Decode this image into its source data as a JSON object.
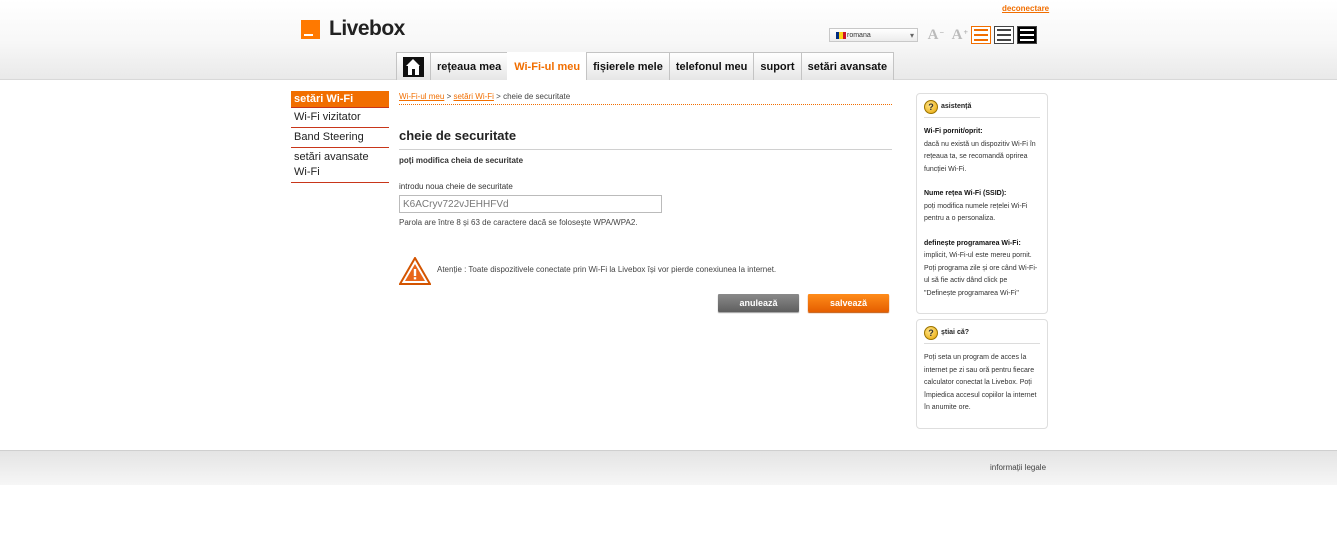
{
  "header": {
    "logo_text": "Livebox",
    "logout": "deconectare",
    "language": "romana",
    "font_decrease_icon": "font-decrease-icon",
    "font_increase_icon": "font-increase-icon"
  },
  "nav": {
    "home_icon": "home-icon",
    "items": [
      "rețeaua mea",
      "Wi-Fi-ul meu",
      "fișierele mele",
      "telefonul meu",
      "suport",
      "setări avansate"
    ],
    "active_index": 1
  },
  "sidebar": {
    "items": [
      "setări Wi-Fi",
      "Wi-Fi vizitator",
      "Band Steering",
      "setări avansate Wi-Fi"
    ],
    "active_index": 0
  },
  "breadcrumb": {
    "level1": "Wi-Fi-ul meu",
    "level2": "setări Wi-Fi",
    "current": "cheie de securitate",
    "separator": ">"
  },
  "main": {
    "title": "cheie de securitate",
    "subtitle": "poți modifica cheia de securitate",
    "field_label": "introdu noua cheie de securitate",
    "field_value": "K6ACryv722vJEHHFVd",
    "hint": "Parola are între 8 și 63 de caractere dacă se folosește WPA/WPA2.",
    "warning": "Atenție : Toate dispozitivele conectate prin Wi-Fi la Livebox își vor pierde conexiunea la internet.",
    "cancel": "anulează",
    "save": "salvează"
  },
  "help": {
    "title": "asistență",
    "sections": [
      {
        "heading": "Wi-Fi pornit/oprit:",
        "lines": [
          "dacă nu există un dispozitiv Wi-Fi în",
          "rețeaua ta, se recomandă oprirea",
          "funcției Wi-Fi."
        ]
      },
      {
        "heading": "Nume rețea Wi-Fi (SSID):",
        "lines": [
          "poți modifica numele rețelei Wi-Fi",
          "pentru a o personaliza."
        ]
      },
      {
        "heading": "definește programarea Wi-Fi:",
        "lines": [
          "implicit, Wi-Fi-ul este mereu pornit.",
          "Poți programa zile și ore când Wi-Fi-",
          "ul să fie activ dând click pe",
          "\"Definește programarea Wi-Fi\""
        ]
      }
    ]
  },
  "tip": {
    "title": "știai că?",
    "lines": [
      "Poți seta un program de acces la",
      "internet pe zi sau oră pentru fiecare",
      "calculator conectat la Livebox. Poți",
      "împiedica accesul copiilor la internet",
      "în anumite ore."
    ]
  },
  "footer": {
    "legal": "informații legale"
  },
  "colors": {
    "accent": "#f16e00",
    "flag": [
      "#002b7f",
      "#fcd116",
      "#ce1126"
    ]
  }
}
